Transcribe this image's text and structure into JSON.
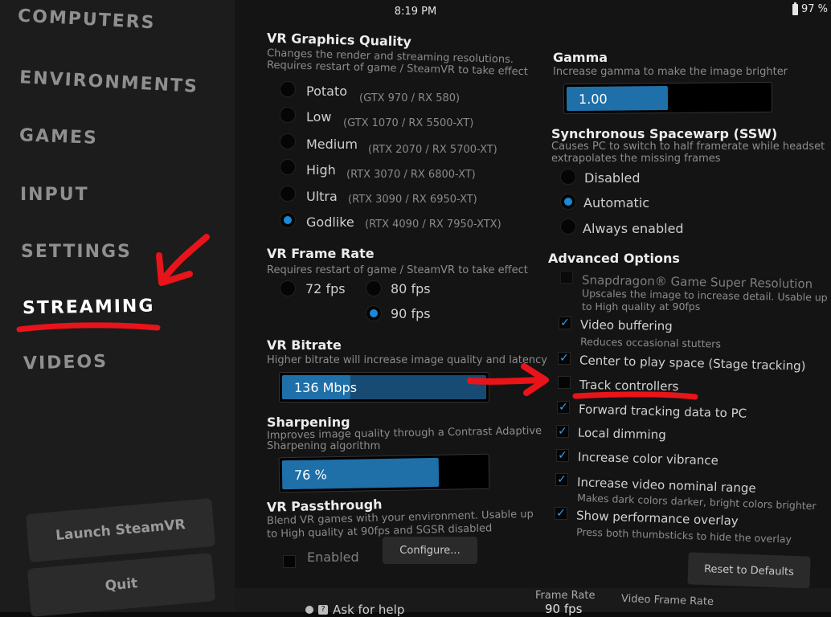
{
  "status": {
    "time": "8:19 PM",
    "battery": "97 %"
  },
  "sidebar": {
    "items": [
      {
        "label": "COMPUTERS"
      },
      {
        "label": "ENVIRONMENTS"
      },
      {
        "label": "GAMES"
      },
      {
        "label": "INPUT"
      },
      {
        "label": "SETTINGS"
      },
      {
        "label": "STREAMING"
      },
      {
        "label": "VIDEOS"
      }
    ],
    "active": "STREAMING",
    "launch_label": "Launch SteamVR",
    "quit_label": "Quit"
  },
  "graphics": {
    "title": "VR Graphics Quality",
    "desc1": "Changes the render and streaming resolutions.",
    "desc2": "Requires restart of game / SteamVR to take effect",
    "options": [
      {
        "label": "Potato",
        "note": "(GTX 970 / RX 580)",
        "selected": false
      },
      {
        "label": "Low",
        "note": "(GTX 1070 / RX 5500-XT)",
        "selected": false
      },
      {
        "label": "Medium",
        "note": "(RTX 2070 / RX 5700-XT)",
        "selected": false
      },
      {
        "label": "High",
        "note": "(RTX 3070 / RX 6800-XT)",
        "selected": false
      },
      {
        "label": "Ultra",
        "note": "(RTX 3090 / RX 6950-XT)",
        "selected": false
      },
      {
        "label": "Godlike",
        "note": "(RTX 4090 / RX 7950-XTX)",
        "selected": true
      }
    ]
  },
  "framerate": {
    "title": "VR Frame Rate",
    "desc": "Requires restart of game / SteamVR to take effect",
    "options": [
      {
        "label": "72 fps",
        "selected": false
      },
      {
        "label": "80 fps",
        "selected": false
      },
      {
        "label": "90 fps",
        "selected": true
      }
    ]
  },
  "bitrate": {
    "title": "VR Bitrate",
    "desc": "Higher bitrate will increase image quality and latency",
    "value": "136 Mbps",
    "level": 0.33
  },
  "sharpening": {
    "title": "Sharpening",
    "desc1": "Improves image quality through a Contrast Adaptive",
    "desc2": "Sharpening algorithm",
    "value": "76 %",
    "level": 0.76
  },
  "passthrough": {
    "title": "VR Passthrough",
    "desc1": "Blend VR games with your environment. Usable up",
    "desc2": "to High quality at 90fps and SGSR disabled",
    "enabled_label": "Enabled",
    "enabled": false,
    "configure_label": "Configure..."
  },
  "gamma": {
    "title": "Gamma",
    "desc": "Increase gamma to make the image brighter",
    "value": "1.00",
    "level": 0.5
  },
  "ssw": {
    "title": "Synchronous Spacewarp (SSW)",
    "desc1": "Causes PC to switch to half framerate while headset",
    "desc2": "extrapolates the missing frames",
    "options": [
      {
        "label": "Disabled",
        "selected": false
      },
      {
        "label": "Automatic",
        "selected": true
      },
      {
        "label": "Always enabled",
        "selected": false
      }
    ]
  },
  "advanced": {
    "title": "Advanced Options",
    "items": [
      {
        "label": "Snapdragon® Game Super Resolution",
        "note": "Upscales the image to increase detail. Usable up",
        "note2": "to High quality at 90fps",
        "checked": false,
        "disabled": true
      },
      {
        "label": "Video buffering",
        "note": "Reduces occasional stutters",
        "checked": true
      },
      {
        "label": "Center to play space (Stage tracking)",
        "checked": true
      },
      {
        "label": "Track controllers",
        "checked": false
      },
      {
        "label": "Forward tracking data to PC",
        "checked": true
      },
      {
        "label": "Local dimming",
        "checked": true
      },
      {
        "label": "Increase color vibrance",
        "checked": true
      },
      {
        "label": "Increase video nominal range",
        "note": "Makes dark colors darker, bright colors brighter",
        "checked": true
      },
      {
        "label": "Show performance overlay",
        "note": "Press both thumbsticks to hide the overlay",
        "checked": true
      }
    ],
    "reset_label": "Reset to Defaults"
  },
  "footer": {
    "help_label": "Ask for help",
    "frame_rate_label": "Frame Rate",
    "frame_rate_value": "90 fps",
    "video_frame_rate_label": "Video Frame Rate"
  },
  "colors": {
    "accent": "#1a8ad8",
    "annotation": "#e8141a"
  }
}
